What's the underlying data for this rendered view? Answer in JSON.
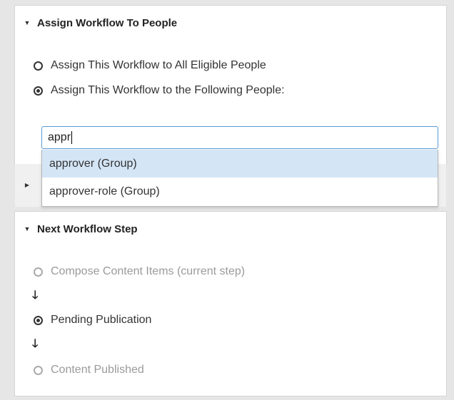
{
  "assign_panel": {
    "title": "Assign Workflow To People",
    "options": [
      {
        "label": "Assign This Workflow to All Eligible People",
        "selected": false
      },
      {
        "label": "Assign This Workflow to the Following People:",
        "selected": true
      }
    ],
    "search": {
      "value": "appr"
    },
    "suggestions": [
      {
        "label": "approver (Group)",
        "highlighted": true
      },
      {
        "label": "approver-role (Group)",
        "highlighted": false
      }
    ]
  },
  "next_step_panel": {
    "title": "Next Workflow Step",
    "steps": [
      {
        "label": "Compose Content Items (current step)",
        "selected": false,
        "disabled": true
      },
      {
        "label": "Pending Publication",
        "selected": true,
        "disabled": false
      },
      {
        "label": "Content Published",
        "selected": false,
        "disabled": true
      }
    ]
  },
  "colors": {
    "highlight": "#d4e5f6",
    "focus_border": "#5a9bd5",
    "background": "#e6e6e6"
  }
}
